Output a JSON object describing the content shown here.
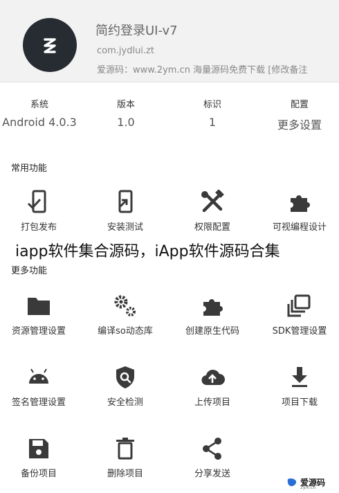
{
  "header": {
    "title": "简约登录UI-v7",
    "package": "com.jydlui.zt",
    "note": "爱源码：www.2ym.cn 海量源码免费下载 [修改备注"
  },
  "info": [
    {
      "label": "系统",
      "value": "Android 4.0.3"
    },
    {
      "label": "版本",
      "value": "1.0"
    },
    {
      "label": "标识",
      "value": "1"
    },
    {
      "label": "配置",
      "value": "更多设置"
    }
  ],
  "sections": {
    "common_title": "常用功能",
    "more_title": "更多功能"
  },
  "common_items": [
    "打包发布",
    "安装测试",
    "权限配置",
    "可视编程设计"
  ],
  "more_items": [
    "资源管理设置",
    "编译so动态库",
    "创建原生代码",
    "SDK管理设置",
    "签名管理设置",
    "安全检测",
    "上传项目",
    "项目下载",
    "备份项目",
    "删除项目",
    "分享发送"
  ],
  "overlay_caption": "iapp软件集合源码，iApp软件源码合集",
  "watermark": {
    "text": "爱源码",
    "sub": "2ym.cn"
  },
  "colors": {
    "icon": "#3a3a3a",
    "app_icon_bg": "#262c32",
    "header_bg": "#f2f2f2"
  }
}
